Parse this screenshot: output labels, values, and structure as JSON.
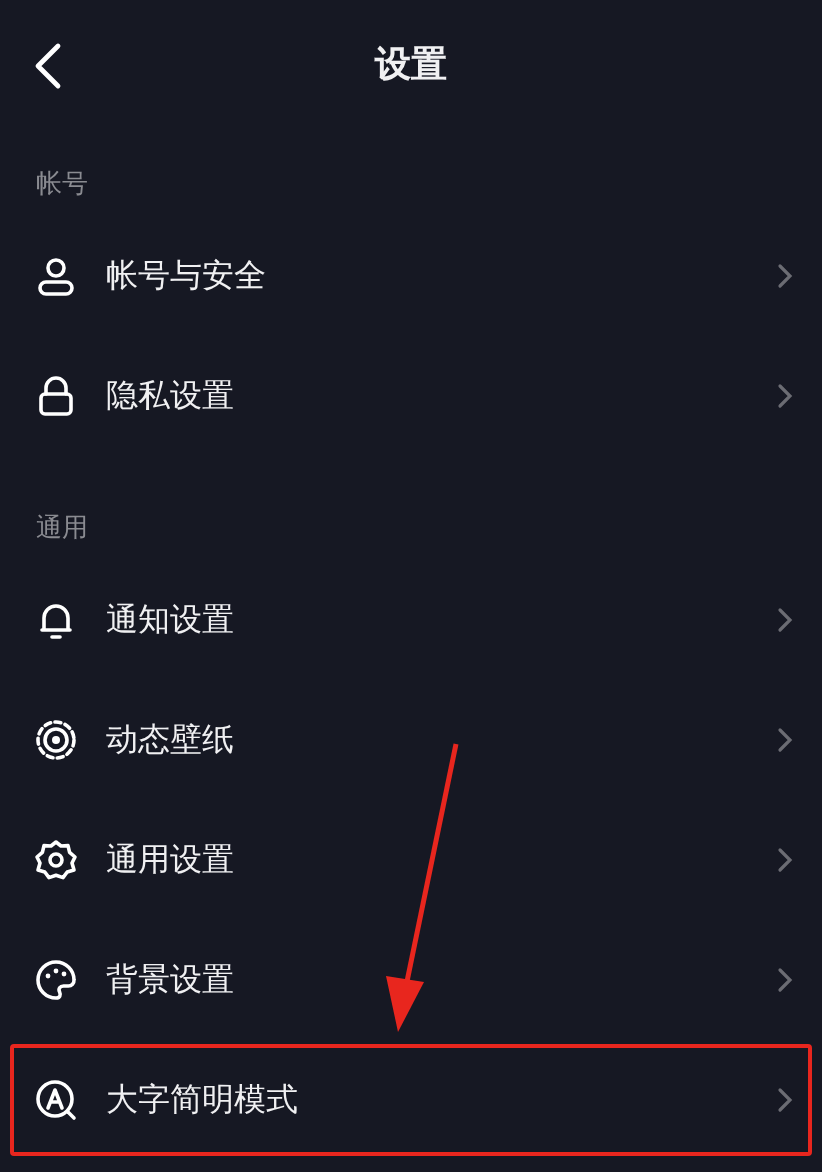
{
  "header": {
    "title": "设置"
  },
  "sections": [
    {
      "label": "帐号",
      "items": [
        {
          "label": "帐号与安全",
          "highlighted": false
        },
        {
          "label": "隐私设置",
          "highlighted": false
        }
      ]
    },
    {
      "label": "通用",
      "items": [
        {
          "label": "通知设置",
          "highlighted": false
        },
        {
          "label": "动态壁纸",
          "highlighted": false
        },
        {
          "label": "通用设置",
          "highlighted": false
        },
        {
          "label": "背景设置",
          "highlighted": false
        },
        {
          "label": "大字简明模式",
          "highlighted": true
        }
      ]
    }
  ]
}
